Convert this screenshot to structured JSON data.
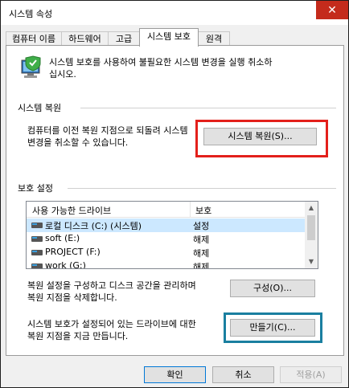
{
  "window": {
    "title": "시스템 속성",
    "close_glyph": "✕"
  },
  "tabs": [
    {
      "label": "컴퓨터 이름"
    },
    {
      "label": "하드웨어"
    },
    {
      "label": "고급"
    },
    {
      "label": "시스템 보호"
    },
    {
      "label": "원격"
    }
  ],
  "intro": {
    "line1": "시스템 보호를 사용하여 불필요한 시스템 변경을 실행 취소하",
    "line2": "십시오."
  },
  "restore": {
    "heading": "시스템 복원",
    "line1": "컴퓨터를 이전 복원 지점으로 되돌려 시스템",
    "line2": "변경을 취소할 수 있습니다.",
    "button": "시스템 복원(S)..."
  },
  "protection": {
    "heading": "보호 설정",
    "columns": [
      "사용 가능한 드라이브",
      "보호"
    ],
    "drives": [
      {
        "name": "로컬 디스크 (C:) (시스템)",
        "status": "설정"
      },
      {
        "name": "soft (E:)",
        "status": "해제"
      },
      {
        "name": "PROJECT (F:)",
        "status": "해제"
      },
      {
        "name": "work (G:)",
        "status": "해제"
      }
    ],
    "configure_line1": "복원 설정을 구성하고 디스크 공간을 관리하며",
    "configure_line2": "복원 지점을 삭제합니다.",
    "configure_button": "구성(O)...",
    "create_line1": "시스템 보호가 설정되어 있는 드라이브에 대한",
    "create_line2": "복원 지점을 지금 만듭니다.",
    "create_button": "만들기(C)..."
  },
  "footer": {
    "ok": "확인",
    "cancel": "취소",
    "apply": "적용(A)"
  }
}
